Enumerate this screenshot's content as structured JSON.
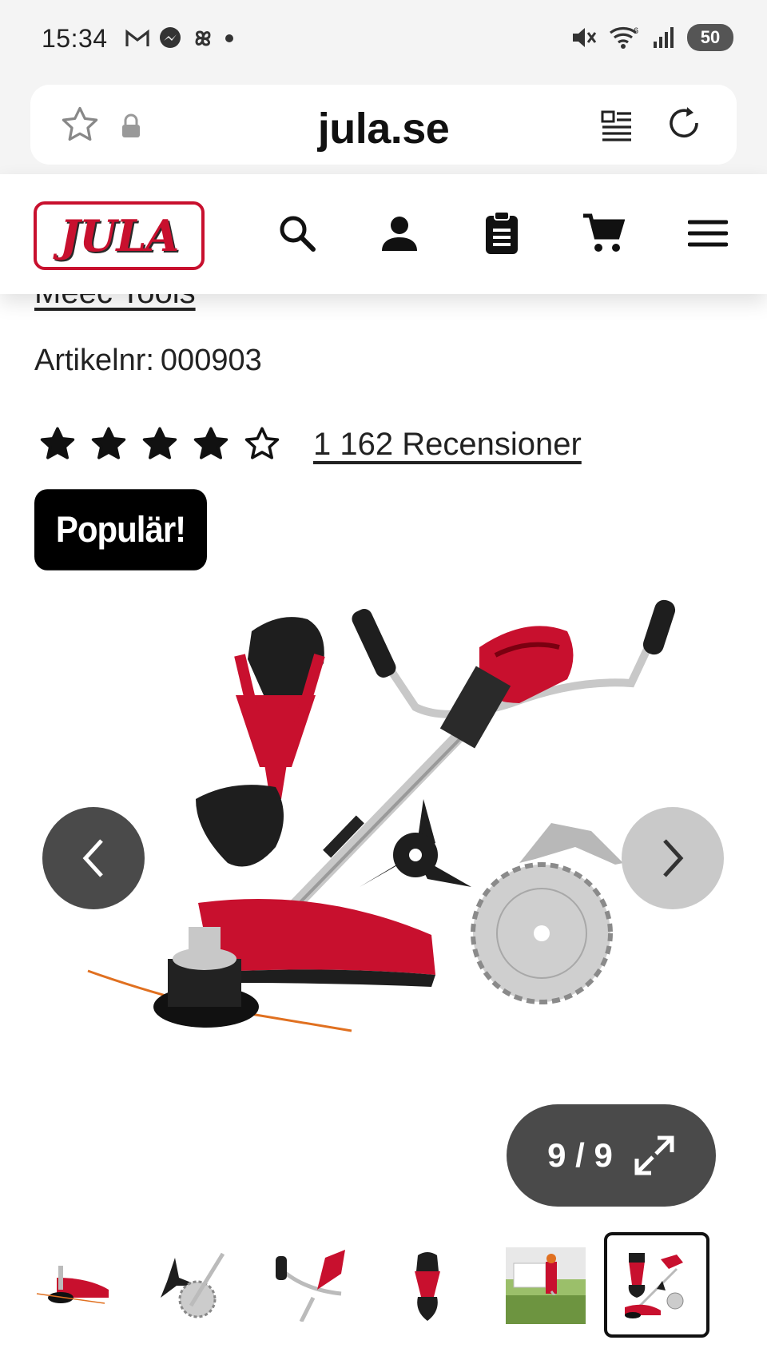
{
  "status_bar": {
    "time": "15:34",
    "battery": "50",
    "left_icons": [
      "gmail-icon",
      "messenger-icon",
      "pinwheel-icon",
      "dot-icon"
    ],
    "right_icons": [
      "mute-icon",
      "wifi-icon",
      "signal-icon",
      "battery-icon"
    ]
  },
  "browser": {
    "url": "jula.se",
    "icons": [
      "star-icon",
      "lock-icon",
      "reader-mode-icon",
      "reload-icon"
    ]
  },
  "site_header": {
    "logo_text": "JULA",
    "icons": [
      "search-icon",
      "account-icon",
      "clipboard-icon",
      "cart-icon",
      "menu-icon"
    ],
    "brand_color": "#c8102e"
  },
  "product": {
    "brand": "Meec Tools",
    "article_label": "Artikelnr:",
    "article_number": "000903",
    "rating": 4.5,
    "rating_max": 5,
    "reviews": "1 162 Recensioner",
    "badge": "Populär!"
  },
  "gallery": {
    "counter": "9 / 9",
    "prev_icon": "chevron-left-icon",
    "next_icon": "chevron-right-icon",
    "expand_icon": "expand-icon",
    "thumbnails": [
      {
        "name": "thumb-trimmer-head",
        "active": false
      },
      {
        "name": "thumb-blades",
        "active": false
      },
      {
        "name": "thumb-handle",
        "active": false
      },
      {
        "name": "thumb-harness",
        "active": false
      },
      {
        "name": "thumb-in-use",
        "active": false
      },
      {
        "name": "thumb-full-kit",
        "active": true
      }
    ]
  }
}
